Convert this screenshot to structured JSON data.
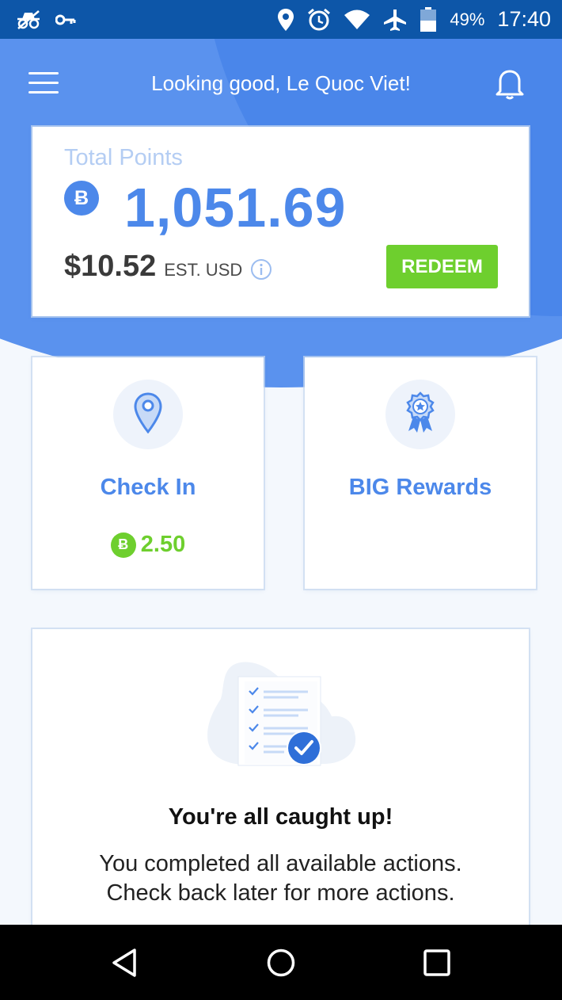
{
  "status_bar": {
    "battery_percent": "49%",
    "time": "17:40",
    "icons": [
      "incognito-icon",
      "key-icon",
      "location-icon",
      "alarm-icon",
      "wifi-icon",
      "airplane-icon",
      "battery-icon"
    ]
  },
  "header": {
    "greeting": "Looking good, Le Quoc Viet!",
    "menu_icon": "menu-icon",
    "bell_icon": "bell-icon"
  },
  "points": {
    "label": "Total Points",
    "coin_symbol": "Ƀ",
    "value": "1,051.69",
    "usd_value": "$10.52",
    "usd_label": "EST. USD",
    "redeem_label": "REDEEM"
  },
  "tiles": [
    {
      "title": "Check In",
      "icon": "location-pin-icon",
      "reward_symbol": "Ƀ",
      "reward": "2.50"
    },
    {
      "title": "BIG Rewards",
      "icon": "award-ribbon-icon"
    }
  ],
  "caught_up": {
    "title": "You're all caught up!",
    "message": "You completed all available actions. Check back later for more actions."
  },
  "nav": [
    "back-icon",
    "home-icon",
    "recents-icon"
  ],
  "colors": {
    "status_bar": "#0d56a8",
    "primary_blue": "#4c88ea",
    "green": "#6ecf2e",
    "background": "#f4f8fd"
  }
}
